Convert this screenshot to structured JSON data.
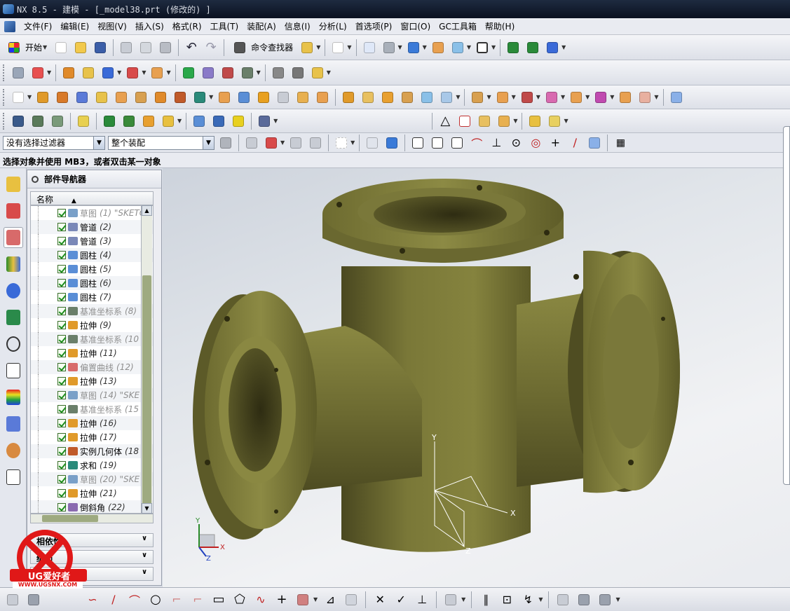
{
  "window": {
    "title": "NX 8.5 - 建模 - [_model38.prt  (修改的) ]"
  },
  "menu": [
    "文件(F)",
    "编辑(E)",
    "视图(V)",
    "插入(S)",
    "格式(R)",
    "工具(T)",
    "装配(A)",
    "信息(I)",
    "分析(L)",
    "首选项(P)",
    "窗口(O)",
    "GC工具箱",
    "帮助(H)"
  ],
  "toolbar": {
    "start_label": "开始",
    "command_finder_label": "命令查找器"
  },
  "selection": {
    "filter_value": "没有选择过滤器",
    "scope_value": "整个装配"
  },
  "cue_line": "选择对象并使用 MB3，或者双击某一对象",
  "navigator": {
    "title": "部件导航器",
    "column_name": "名称",
    "items": [
      {
        "name": "草图",
        "num": "(1) \"SKETC",
        "dim": true,
        "color": "#7aa0c8"
      },
      {
        "name": "管道",
        "num": "(2)",
        "dim": false,
        "color": "#7a88b8"
      },
      {
        "name": "管道",
        "num": "(3)",
        "dim": false,
        "color": "#7a88b8"
      },
      {
        "name": "圆柱",
        "num": "(4)",
        "dim": false,
        "color": "#5a8ed6"
      },
      {
        "name": "圆柱",
        "num": "(5)",
        "dim": false,
        "color": "#5a8ed6"
      },
      {
        "name": "圆柱",
        "num": "(6)",
        "dim": false,
        "color": "#5a8ed6"
      },
      {
        "name": "圆柱",
        "num": "(7)",
        "dim": false,
        "color": "#5a8ed6"
      },
      {
        "name": "基准坐标系",
        "num": "(8)",
        "dim": true,
        "color": "#6a7f6a"
      },
      {
        "name": "拉伸",
        "num": "(9)",
        "dim": false,
        "color": "#e09a2a"
      },
      {
        "name": "基准坐标系",
        "num": "(10",
        "dim": true,
        "color": "#6a7f6a"
      },
      {
        "name": "拉伸",
        "num": "(11)",
        "dim": false,
        "color": "#e09a2a"
      },
      {
        "name": "偏置曲线",
        "num": "(12)",
        "dim": true,
        "color": "#d86b6b"
      },
      {
        "name": "拉伸",
        "num": "(13)",
        "dim": false,
        "color": "#e09a2a"
      },
      {
        "name": "草图",
        "num": "(14) \"SKE",
        "dim": true,
        "color": "#7aa0c8"
      },
      {
        "name": "基准坐标系",
        "num": "(15",
        "dim": true,
        "color": "#6a7f6a"
      },
      {
        "name": "拉伸",
        "num": "(16)",
        "dim": false,
        "color": "#e09a2a"
      },
      {
        "name": "拉伸",
        "num": "(17)",
        "dim": false,
        "color": "#e09a2a"
      },
      {
        "name": "实例几何体",
        "num": "(18",
        "dim": false,
        "color": "#c05a2a"
      },
      {
        "name": "求和",
        "num": "(19)",
        "dim": false,
        "color": "#2a8a7a"
      },
      {
        "name": "草图",
        "num": "(20) \"SKE",
        "dim": true,
        "color": "#7aa0c8"
      },
      {
        "name": "拉伸",
        "num": "(21)",
        "dim": false,
        "color": "#e09a2a"
      },
      {
        "name": "倒斜角",
        "num": "(22)",
        "dim": false,
        "color": "#8a6ab0"
      }
    ],
    "sections": [
      "相依性",
      "细节",
      "预览"
    ]
  },
  "viewport": {
    "model_color": "#6e6b33",
    "triad": {
      "x": "X",
      "y": "Y",
      "z": "Z"
    }
  },
  "watermark": {
    "brand": "UG爱好者",
    "url": "WWW.UGSNX.COM"
  },
  "colors": {
    "accent": "#1e4f9a",
    "check": "#1b8a1b",
    "scrollbar": "#9eaa80"
  }
}
